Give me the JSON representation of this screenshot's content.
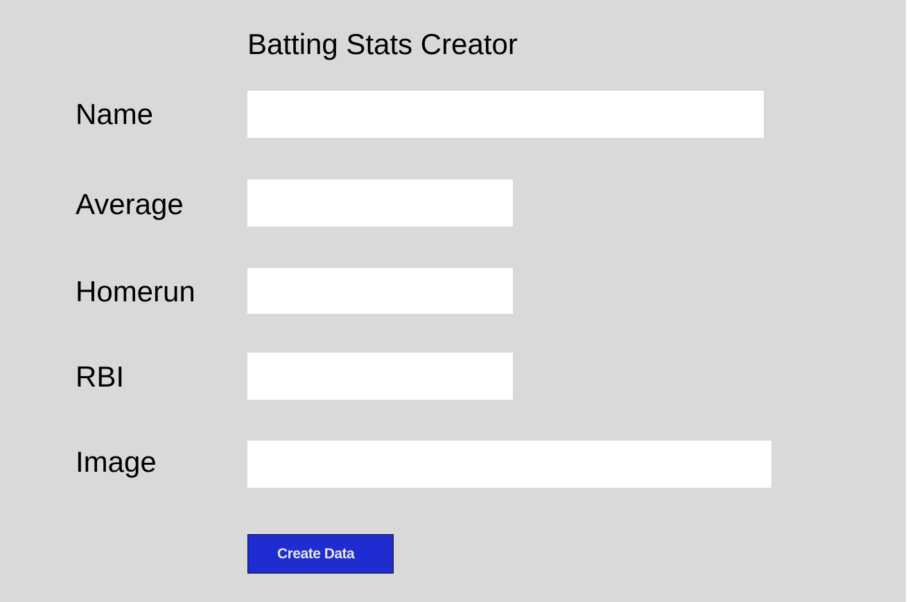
{
  "form": {
    "title": "Batting Stats Creator",
    "fields": [
      {
        "label": "Name",
        "value": "",
        "placeholder": ""
      },
      {
        "label": "Average",
        "value": "",
        "placeholder": ""
      },
      {
        "label": "Homerun",
        "value": "",
        "placeholder": ""
      },
      {
        "label": "RBI",
        "value": "",
        "placeholder": ""
      },
      {
        "label": "Image",
        "value": "",
        "placeholder": ""
      }
    ],
    "submit_label": "Create Data"
  },
  "colors": {
    "page_background": "#d9d9d9",
    "input_background": "#ffffff",
    "button_background": "#1f2ccf",
    "button_text": "#e6e6e6"
  }
}
